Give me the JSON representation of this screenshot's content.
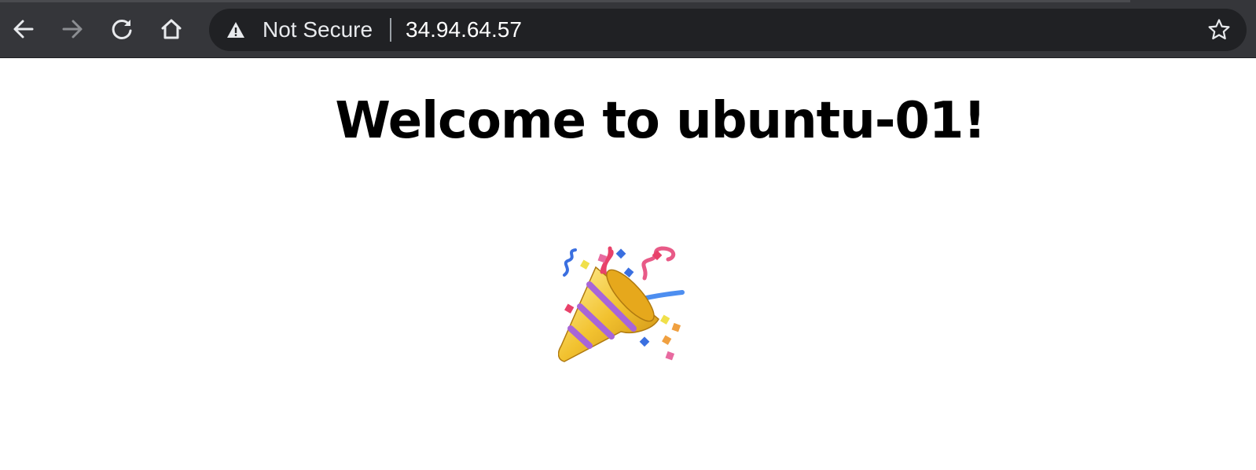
{
  "browser": {
    "nav": {
      "back_icon": "arrow-left-icon",
      "forward_icon": "arrow-right-icon",
      "reload_icon": "reload-icon",
      "home_icon": "home-icon"
    },
    "omnibox": {
      "security_icon": "warning-triangle-icon",
      "security_label": "Not Secure",
      "url": "34.94.64.57",
      "bookmark_icon": "star-icon"
    }
  },
  "page": {
    "heading": "Welcome to ubuntu-01!",
    "emoji": "party-popper",
    "emoji_char": "🎉"
  }
}
